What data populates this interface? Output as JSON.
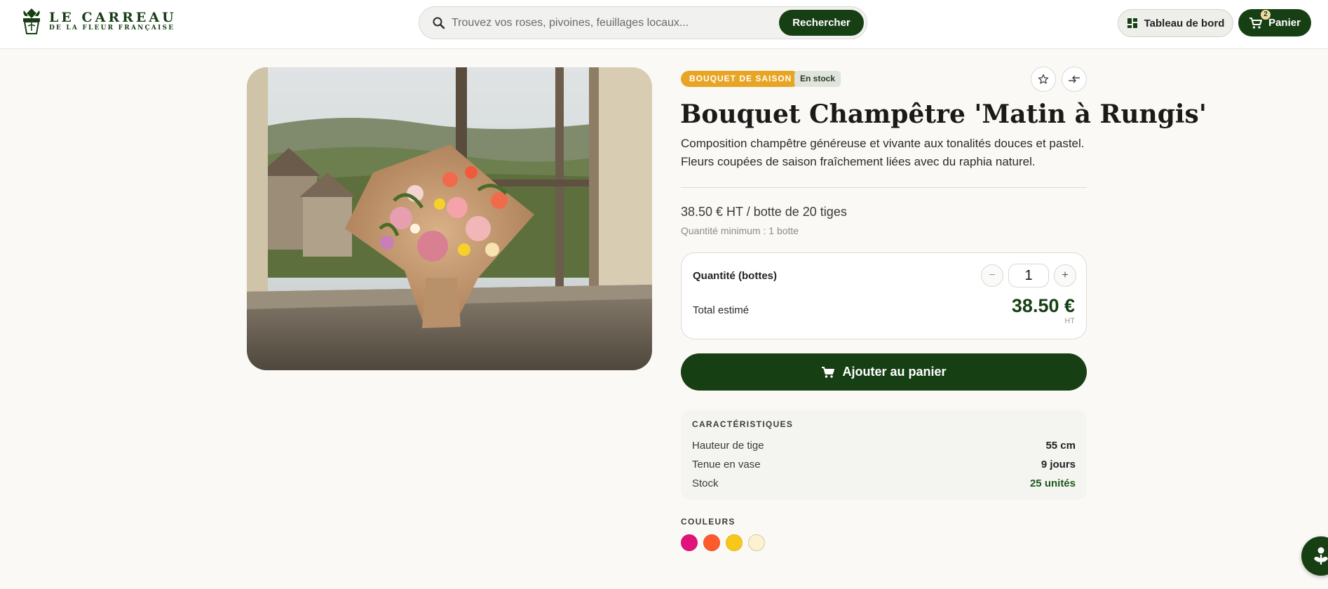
{
  "header": {
    "logo": {
      "line1": "LE CARREAU",
      "line2": "DE LA FLEUR FRANÇAISE"
    },
    "search": {
      "placeholder": "Trouvez vos roses, pivoines, feuillages locaux...",
      "button_label": "Rechercher"
    },
    "dashboard_label": "Tableau de bord",
    "cart": {
      "label": "Panier",
      "count": "2"
    }
  },
  "product": {
    "badge_season": "BOUQUET DE SAISON",
    "badge_stock": "En stock",
    "title": "Bouquet Champêtre 'Matin à Rungis'",
    "description_line1": "Composition champêtre généreuse et vivante aux tonalités douces et pastel.",
    "description_line2": "Fleurs coupées de saison fraîchement liées avec du raphia naturel.",
    "price": "38.50 € HT / botte de 20 tiges",
    "min_quantity": "Quantité minimum : 1 botte",
    "image_alt": "Bouquet champêtre sur le rebord d'une fenêtre"
  },
  "quantity": {
    "label": "Quantité (bottes)",
    "value": "1",
    "minus": "−",
    "plus": "+",
    "total_label": "Total estimé",
    "total_value": "38.50 €",
    "total_suffix": "HT"
  },
  "add_to_cart_label": "Ajouter au panier",
  "specs": {
    "title": "CARACTÉRISTIQUES",
    "rows": [
      {
        "label": "Hauteur de tige",
        "value": "55 cm"
      },
      {
        "label": "Tenue en vase",
        "value": "9 jours"
      },
      {
        "label": "Stock",
        "value": "25 unités"
      }
    ]
  },
  "colors": {
    "title": "COULEURS",
    "swatches": [
      "#e0137a",
      "#ff5a2c",
      "#f7c71b",
      "#fdf1d2"
    ]
  },
  "theme": {
    "brand": "#173f14",
    "accent": "#e8a423"
  }
}
